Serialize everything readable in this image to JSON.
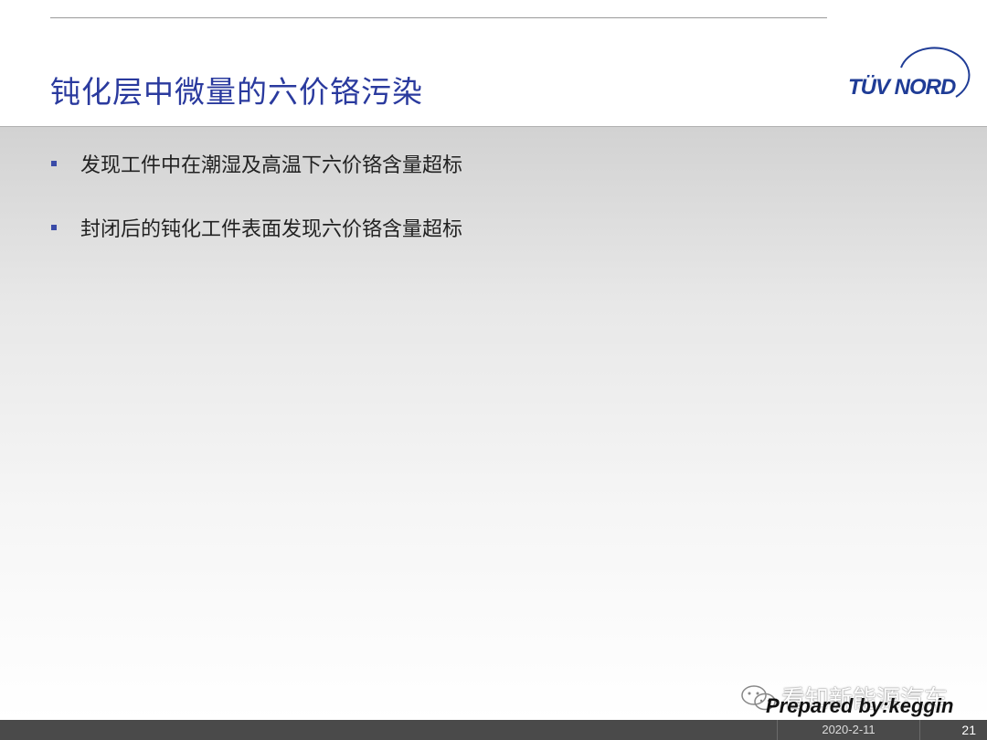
{
  "slide": {
    "title": "钝化层中微量的六价铬污染",
    "bullets": [
      "发现工件中在潮湿及高温下六价铬含量超标",
      "封闭后的钝化工件表面发现六价铬含量超标"
    ]
  },
  "logo": {
    "text": "TÜV NORD",
    "color": "#1f3c96"
  },
  "watermark": {
    "text": "看知新能源汽车",
    "icon": "wechat-icon"
  },
  "prepared_by": "Prepared by:keggin",
  "footer": {
    "date": "2020-2-11",
    "page": "21"
  },
  "colors": {
    "title": "#2a3a9e",
    "bullet_mark": "#3a4ba8",
    "footer_bar": "#4a4a4a"
  }
}
